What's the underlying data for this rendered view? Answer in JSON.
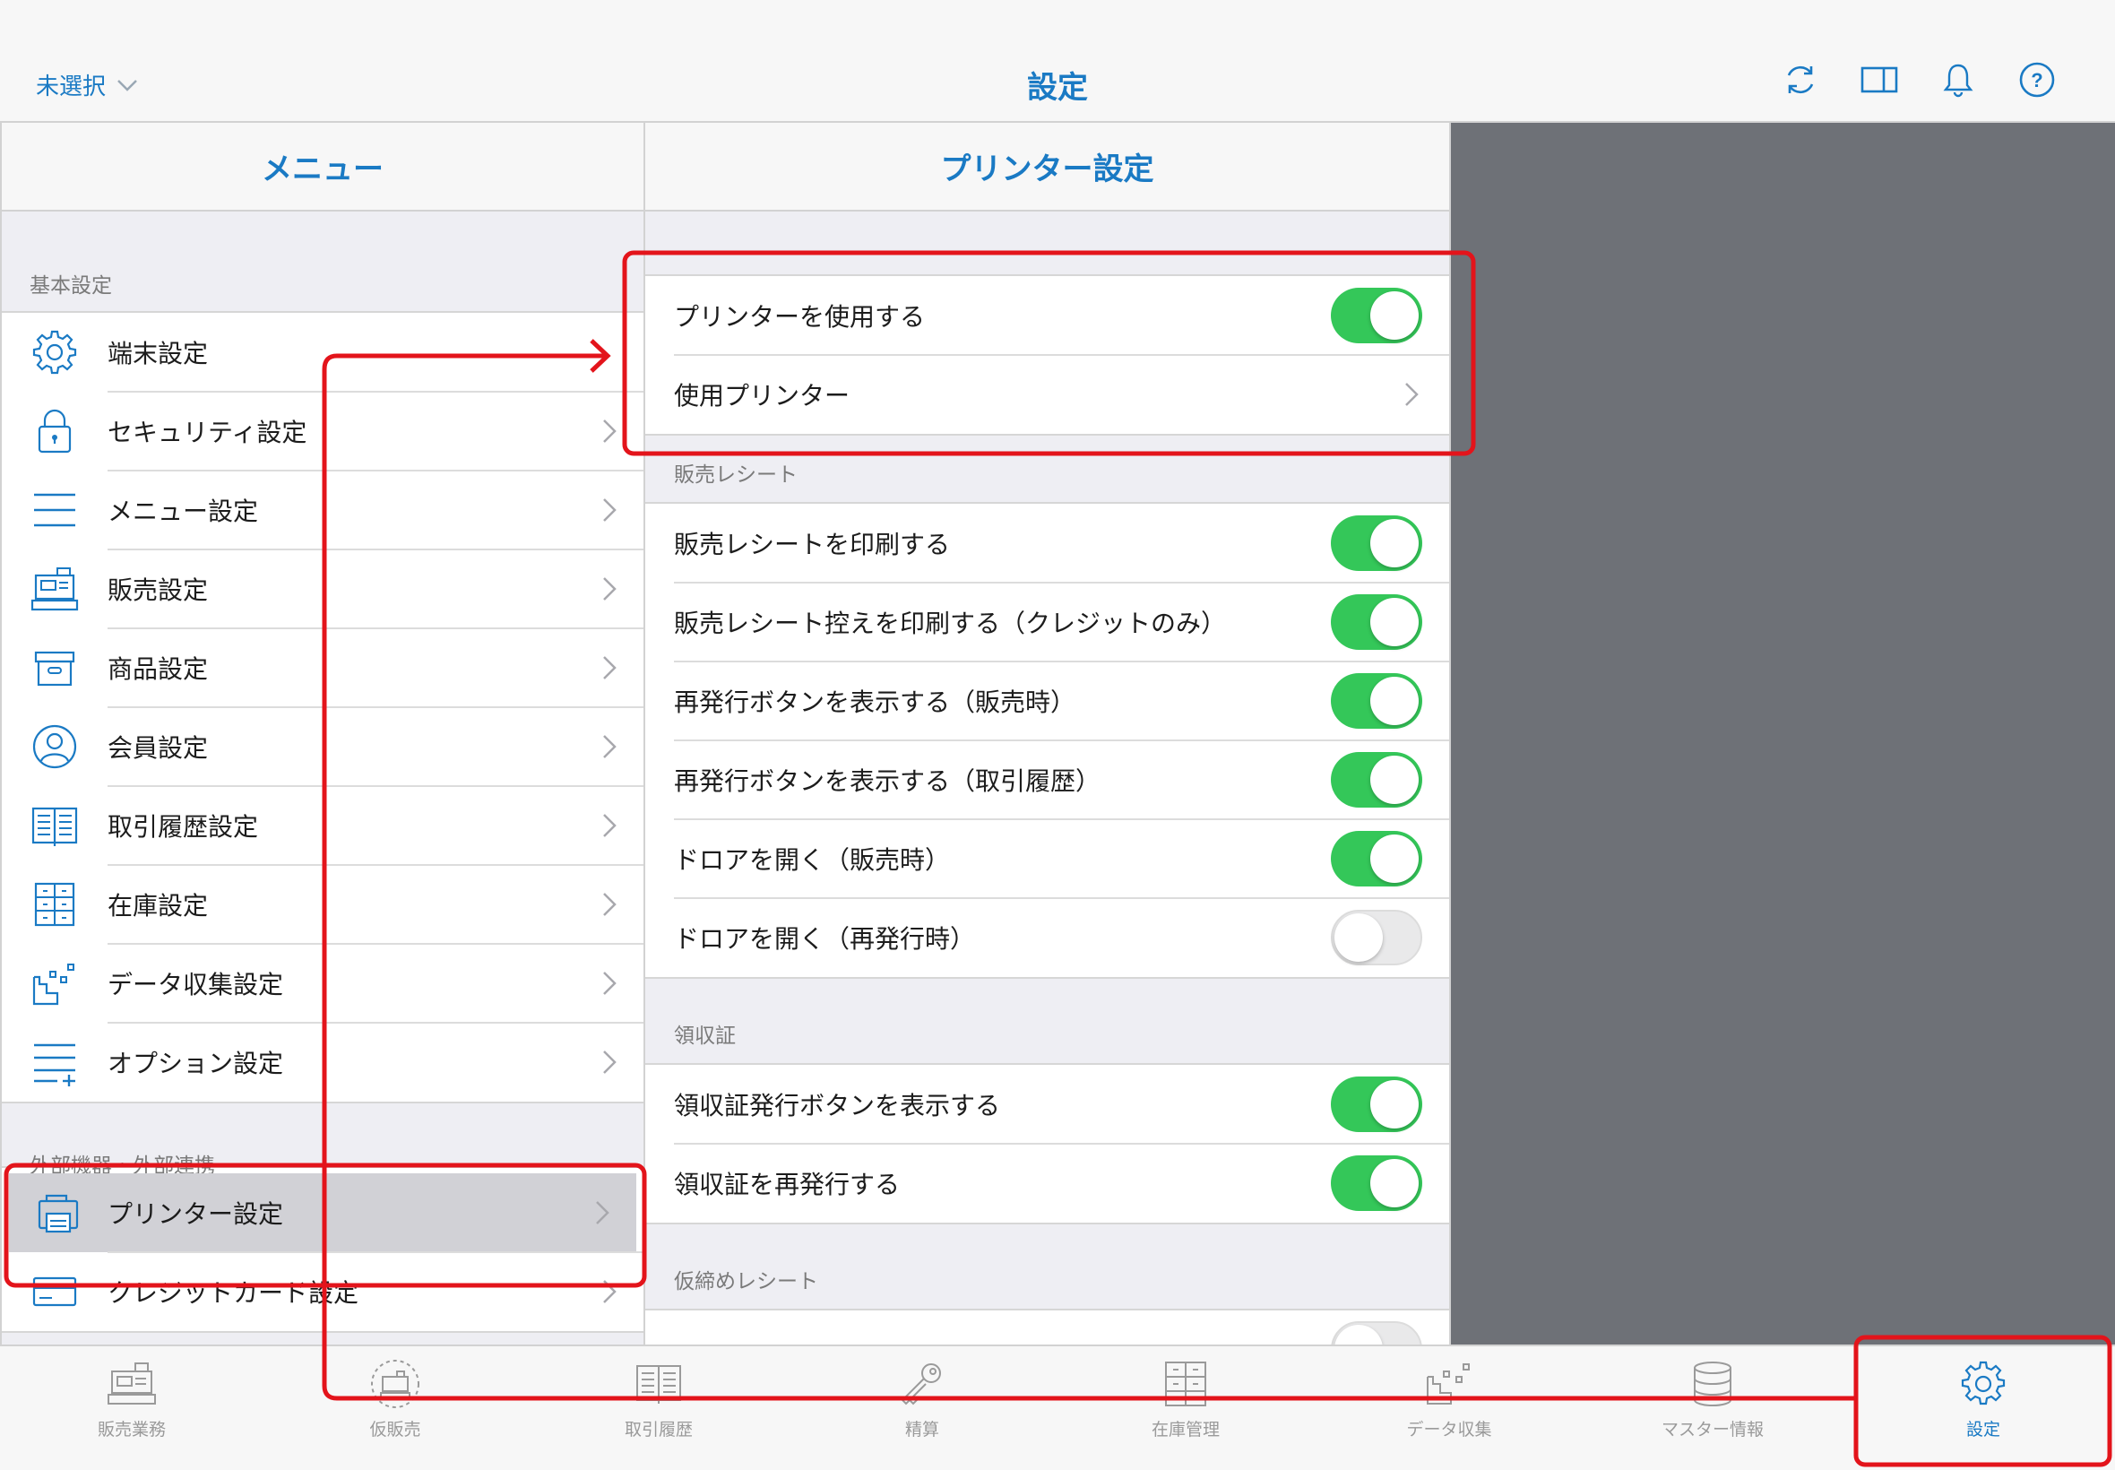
{
  "header": {
    "store_select": "未選択",
    "title": "設定",
    "icons": [
      "refresh-icon",
      "split-view-icon",
      "bell-icon",
      "help-icon"
    ]
  },
  "menu": {
    "title": "メニュー",
    "section_basic": "基本設定",
    "items": [
      {
        "label": "端末設定",
        "icon": "gear-icon"
      },
      {
        "label": "セキュリティ設定",
        "icon": "lock-icon"
      },
      {
        "label": "メニュー設定",
        "icon": "list-icon"
      },
      {
        "label": "販売設定",
        "icon": "register-icon"
      },
      {
        "label": "商品設定",
        "icon": "box-icon"
      },
      {
        "label": "会員設定",
        "icon": "person-icon"
      },
      {
        "label": "取引履歴設定",
        "icon": "book-icon"
      },
      {
        "label": "在庫設定",
        "icon": "drawers-icon"
      },
      {
        "label": "データ収集設定",
        "icon": "chart-icon"
      },
      {
        "label": "オプション設定",
        "icon": "list-plus-icon"
      }
    ],
    "section_external": "外部機器・外部連携",
    "external_items": [
      {
        "label": "プリンター設定",
        "icon": "printer-icon",
        "selected": true
      },
      {
        "label": "クレジットカード設定",
        "icon": "card-icon"
      }
    ]
  },
  "detail": {
    "title": "プリンター設定",
    "printer_group": [
      {
        "label": "プリンターを使用する",
        "toggle": true
      },
      {
        "label": "使用プリンター",
        "chevron": true
      }
    ],
    "sales_section": "販売レシート",
    "sales_rows": [
      {
        "label": "販売レシートを印刷する",
        "on": true
      },
      {
        "label": "販売レシート控えを印刷する（クレジットのみ）",
        "on": true
      },
      {
        "label": "再発行ボタンを表示する（販売時）",
        "on": true
      },
      {
        "label": "再発行ボタンを表示する（取引履歴）",
        "on": true
      },
      {
        "label": "ドロアを開く（販売時）",
        "on": true
      },
      {
        "label": "ドロアを開く（再発行時）",
        "on": false
      }
    ],
    "receipt_section": "領収証",
    "receipt_rows": [
      {
        "label": "領収証発行ボタンを表示する",
        "on": true
      },
      {
        "label": "領収証を再発行する",
        "on": true
      }
    ],
    "temp_section": "仮締めレシート"
  },
  "tabs": [
    {
      "label": "販売業務",
      "icon": "register-icon"
    },
    {
      "label": "仮販売",
      "icon": "temp-register-icon"
    },
    {
      "label": "取引履歴",
      "icon": "book-icon"
    },
    {
      "label": "精算",
      "icon": "key-icon"
    },
    {
      "label": "在庫管理",
      "icon": "drawers-icon"
    },
    {
      "label": "データ収集",
      "icon": "chart-icon"
    },
    {
      "label": "マスター情報",
      "icon": "database-icon"
    },
    {
      "label": "設定",
      "icon": "gear-icon",
      "active": true
    }
  ],
  "colors": {
    "accent": "#1a7ac4",
    "toggle_on": "#34c759",
    "annotation": "#e3141b",
    "side_panel": "#6e7177"
  }
}
